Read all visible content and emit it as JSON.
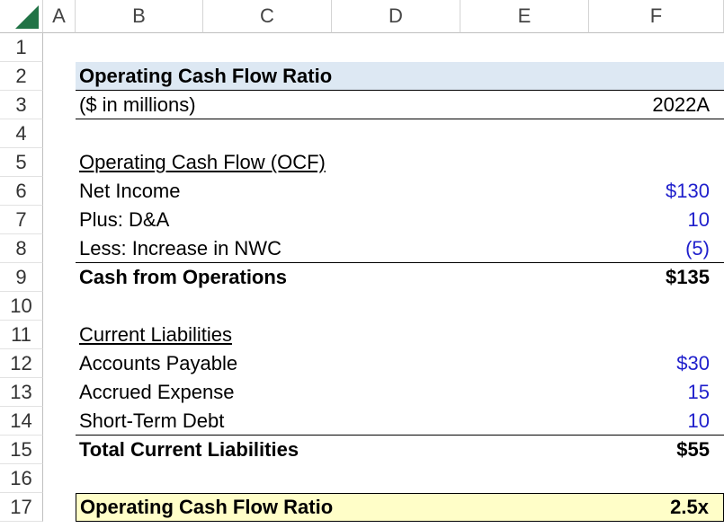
{
  "columns": [
    "A",
    "B",
    "C",
    "D",
    "E",
    "F"
  ],
  "rows": [
    "1",
    "2",
    "3",
    "4",
    "5",
    "6",
    "7",
    "8",
    "9",
    "10",
    "11",
    "12",
    "13",
    "14",
    "15",
    "16",
    "17"
  ],
  "title": "Operating Cash Flow Ratio",
  "units": "($ in millions)",
  "year": "2022A",
  "ocf": {
    "header": "Operating Cash Flow (OCF)",
    "net_income_label": "Net Income",
    "net_income_value": "$130",
    "da_label": "Plus: D&A",
    "da_value": "10",
    "nwc_label": "Less: Increase in NWC",
    "nwc_value": "(5)",
    "cfo_label": "Cash from Operations",
    "cfo_value": "$135"
  },
  "liabilities": {
    "header": "Current Liabilities",
    "ap_label": "Accounts Payable",
    "ap_value": "$30",
    "accrued_label": "Accrued Expense",
    "accrued_value": "15",
    "std_label": "Short-Term Debt",
    "std_value": "10",
    "total_label": "Total Current Liabilities",
    "total_value": "$55"
  },
  "result": {
    "label": "Operating Cash Flow Ratio",
    "value": "2.5x"
  },
  "colors": {
    "title_band": "#dde8f3",
    "result_highlight": "#fffec8",
    "input_blue": "#1f1fcc",
    "excel_green": "#217346"
  }
}
